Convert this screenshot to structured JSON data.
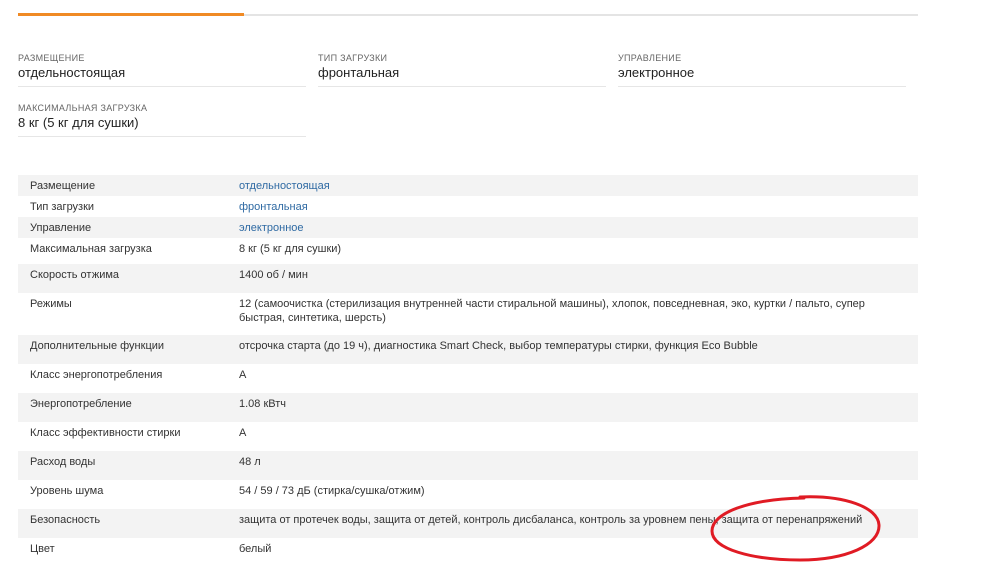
{
  "summary": [
    {
      "label": "РАЗМЕЩЕНИЕ",
      "value": "отдельностоящая"
    },
    {
      "label": "ТИП ЗАГРУЗКИ",
      "value": "фронтальная"
    },
    {
      "label": "УПРАВЛЕНИЕ",
      "value": "электронное"
    },
    {
      "label": "МАКСИМАЛЬНАЯ ЗАГРУЗКА",
      "value": "8 кг (5 кг для сушки)"
    }
  ],
  "specs": [
    {
      "key": "Размещение",
      "value": "отдельностоящая",
      "is_link": true
    },
    {
      "key": "Тип загрузки",
      "value": "фронтальная",
      "is_link": true
    },
    {
      "key": "Управление",
      "value": "электронное",
      "is_link": true
    },
    {
      "key": "Максимальная загрузка",
      "value": "8 кг (5 кг для сушки)",
      "is_link": false
    },
    {
      "key": "Скорость отжима",
      "value": "1400 об / мин",
      "is_link": false
    },
    {
      "key": "Режимы",
      "value": "12 (самоочистка (стерилизация внутренней части стиральной машины), хлопок, повседневная, эко, куртки / пальто, супер быстрая, синтетика, шерсть)",
      "is_link": false
    },
    {
      "key": "Дополнительные функции",
      "value": "отсрочка старта (до 19 ч), диагностика Smart Check, выбор температуры стирки, функция Eco Bubble",
      "is_link": false
    },
    {
      "key": "Класс энергопотребления",
      "value": "A",
      "is_link": false
    },
    {
      "key": "Энергопотребление",
      "value": "1.08 кВтч",
      "is_link": false
    },
    {
      "key": "Класс эффективности стирки",
      "value": "A",
      "is_link": false
    },
    {
      "key": "Расход воды",
      "value": "48 л",
      "is_link": false
    },
    {
      "key": "Уровень шума",
      "value": "54 / 59 / 73 дБ (стирка/сушка/отжим)",
      "is_link": false
    },
    {
      "key": "Безопасность",
      "value": "защита от протечек воды, защита от детей, контроль дисбаланса, контроль за уровнем пены, защита от перенапряжений",
      "is_link": false
    },
    {
      "key": "Цвет",
      "value": "белый",
      "is_link": false
    }
  ],
  "colors": {
    "accent": "#f08a24",
    "link": "#2f6aa3",
    "annotation": "#e01b24",
    "row_alt": "#f3f3f3"
  }
}
